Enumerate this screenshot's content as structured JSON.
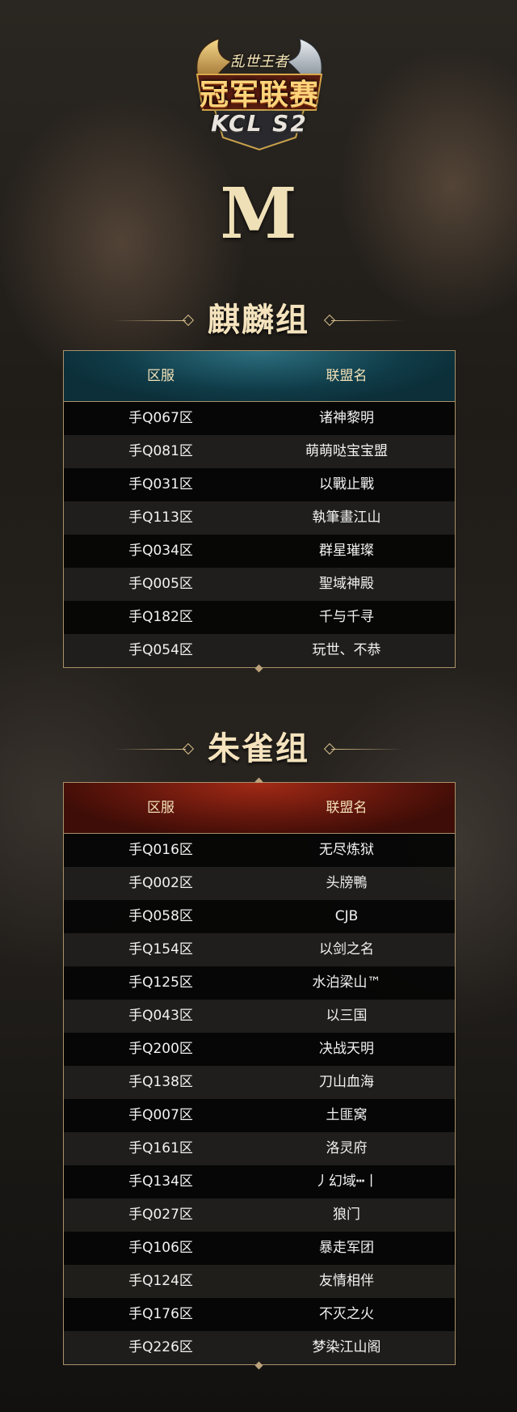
{
  "logo": {
    "top_text": "乱世王者",
    "main_text": "冠军联赛",
    "sub_text": "KCL S2"
  },
  "group_letter": "M",
  "groups": [
    {
      "title": "麒麟组",
      "headers": [
        "区服",
        "联盟名"
      ],
      "rows": [
        [
          "手Q067区",
          "诸神黎明"
        ],
        [
          "手Q081区",
          "萌萌哒宝宝盟"
        ],
        [
          "手Q031区",
          "以戰止戰"
        ],
        [
          "手Q113区",
          "執筆畫江山"
        ],
        [
          "手Q034区",
          "群星璀璨"
        ],
        [
          "手Q005区",
          "聖域神殿"
        ],
        [
          "手Q182区",
          "千与千寻"
        ],
        [
          "手Q054区",
          "玩世、不恭"
        ]
      ]
    },
    {
      "title": "朱雀组",
      "headers": [
        "区服",
        "联盟名"
      ],
      "rows": [
        [
          "手Q016区",
          "无尽炼狱"
        ],
        [
          "手Q002区",
          "头牓鴨"
        ],
        [
          "手Q058区",
          "CJB"
        ],
        [
          "手Q154区",
          "以剑之名"
        ],
        [
          "手Q125区",
          "水泊梁山™"
        ],
        [
          "手Q043区",
          "以三国"
        ],
        [
          "手Q200区",
          "决战天明"
        ],
        [
          "手Q138区",
          "刀山血海"
        ],
        [
          "手Q007区",
          "土匪窝"
        ],
        [
          "手Q161区",
          "洛灵府"
        ],
        [
          "手Q134区",
          "丿幻域┅丨"
        ],
        [
          "手Q027区",
          "狼门"
        ],
        [
          "手Q106区",
          "暴走军团"
        ],
        [
          "手Q124区",
          "友情相伴"
        ],
        [
          "手Q176区",
          "不灭之火"
        ],
        [
          "手Q226区",
          "梦染江山阁"
        ]
      ]
    }
  ]
}
